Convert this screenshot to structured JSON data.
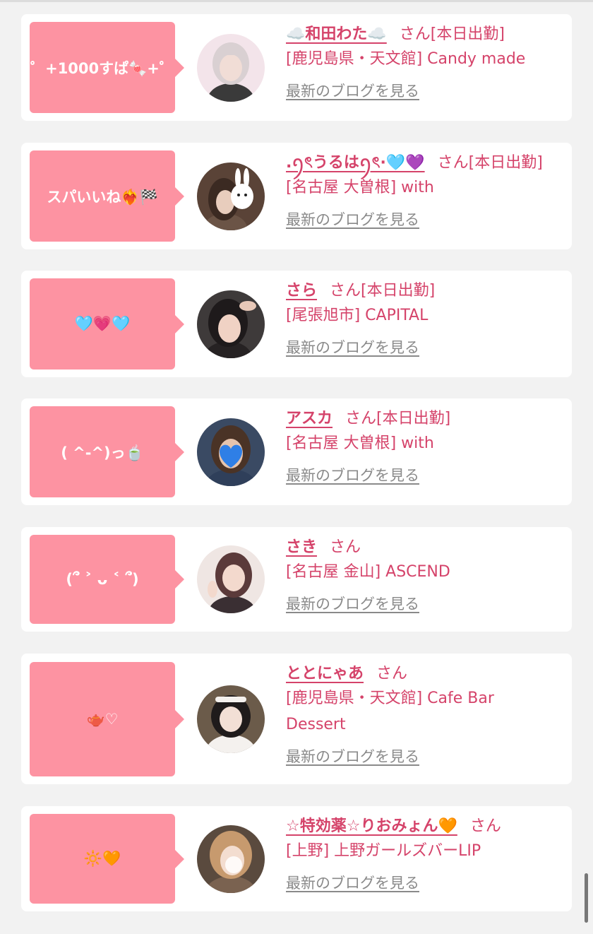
{
  "entries": [
    {
      "bubble": "゜+1000すぱ🍬+゜",
      "name": "☁️和田わた☁️",
      "honorific": "さん[本日出勤]",
      "shop": "[鹿児島県・天文館] Candy made",
      "blog_link": "最新のブログを見る",
      "avatar_colors": {
        "bg": "#f3e4ea",
        "skin": "#f1ddd6",
        "hair": "#d9d0d2",
        "top": "#3a3a3a"
      }
    },
    {
      "bubble": "スパいいね❤️‍🔥🏁",
      "name": ".ꪆৎうるはꪆৎ·🩵💜",
      "honorific": "さん[本日出勤]",
      "shop": "[名古屋 大曽根] with",
      "blog_link": "最新のブログを見る",
      "avatar_colors": {
        "bg": "#5a4337",
        "skin": "#e8cdbd",
        "hair": "#3b2a22",
        "top": "#6b5446"
      }
    },
    {
      "bubble": "🩵💗🩵",
      "name": "さら",
      "honorific": "さん[本日出勤]",
      "shop": "[尾張旭市] CAPITAL",
      "blog_link": "最新のブログを見る",
      "avatar_colors": {
        "bg": "#3e3a3a",
        "skin": "#f0d2c4",
        "hair": "#1e1a1b",
        "top": "#262223"
      }
    },
    {
      "bubble": "( ^-^)っ🍵",
      "name": "アスカ",
      "honorific": "さん[本日出勤]",
      "shop": "[名古屋 大曽根] with",
      "blog_link": "最新のブログを見る",
      "avatar_colors": {
        "bg": "#3a4a63",
        "skin": "#e6c4ad",
        "hair": "#4a3326",
        "top": "#2f3f5a"
      }
    },
    {
      "bubble": "(՞ ˃ ᴗ ˂ ՞)",
      "name": "さき",
      "honorific": "さん",
      "shop": "[名古屋 金山] ASCEND",
      "blog_link": "最新のブログを見る",
      "avatar_colors": {
        "bg": "#efe6e3",
        "skin": "#f3d9cd",
        "hair": "#5b3a3a",
        "top": "#3a2f33"
      }
    },
    {
      "bubble": "🫖♡",
      "name": "ととにゃあ",
      "honorific": "さん",
      "shop": "[鹿児島県・天文館] Cafe Bar Dessert",
      "blog_link": "最新のブログを見る",
      "avatar_colors": {
        "bg": "#6b5b4a",
        "skin": "#f2dfd5",
        "hair": "#1f1b1b",
        "top": "#f4f1ee"
      }
    },
    {
      "bubble": "🔆🧡",
      "name": "☆特効薬☆りおみょん🧡",
      "honorific": "さん",
      "shop": "[上野] 上野ガールズバーLIP",
      "blog_link": "最新のブログを見る",
      "avatar_colors": {
        "bg": "#5a4a3e",
        "skin": "#f3ddd0",
        "hair": "#c79a6e",
        "top": "#7a6250"
      }
    }
  ]
}
